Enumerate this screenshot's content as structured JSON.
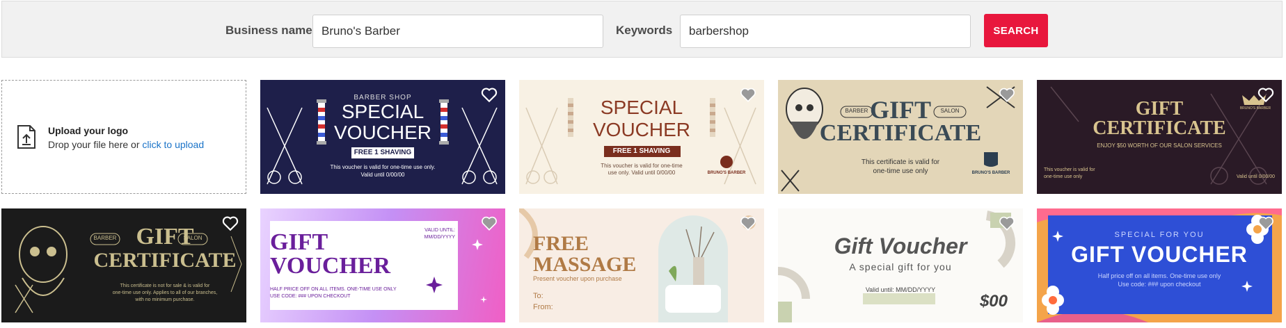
{
  "search": {
    "business_label": "Business name",
    "business_value": "Bruno's Barber",
    "keywords_label": "Keywords",
    "keywords_value": "barbershop",
    "button": "SEARCH"
  },
  "upload": {
    "title": "Upload your logo",
    "text": "Drop your file here or",
    "link": "click to upload"
  },
  "colors": {
    "accent": "#e8173d",
    "link": "#1a73c8"
  },
  "cards": [
    {
      "kicker": "BARBER SHOP",
      "line1": "SPECIAL",
      "line2": "VOUCHER",
      "ribbon": "FREE 1 SHAVING",
      "foot1": "This voucher is valid for one-time use only.",
      "foot2": "Valid until 0/00/00"
    },
    {
      "line1": "SPECIAL",
      "line2": "VOUCHER",
      "ribbon": "FREE 1 SHAVING",
      "foot1": "This voucher is valid for one-time",
      "foot2": "use only. Valid until 0/00/00",
      "brand": "BRUNO'S BARBER"
    },
    {
      "left": "BARBER",
      "right": "SALON",
      "line1": "GIFT",
      "line2": "CERTIFICATE",
      "foot1": "This certificate is valid for",
      "foot2": "one-time use only",
      "brand": "BRUNO'S BARBER"
    },
    {
      "line1": "GIFT",
      "line2": "CERTIFICATE",
      "sub": "ENJOY $50 WORTH OF OUR SALON SERVICES",
      "foot1": "This voucher is valid for",
      "foot2": "one-time use only",
      "date": "Valid until 0/00/00",
      "brand": "BRUNO'S BARBER"
    },
    {
      "left": "BARBER",
      "right": "SALON",
      "line1": "GIFT",
      "line2": "CERTIFICATE",
      "foot1": "This certificate is not for sale & is valid for",
      "foot2": "one-time use only. Applies to all of our branches,",
      "foot3": "with no minimum purchase."
    },
    {
      "line1": "GIFT",
      "line2": "VOUCHER",
      "valid1": "VALID UNTIL:",
      "valid2": "MM/DD/YYYY",
      "foot1": "HALF PRICE OFF ON ALL ITEMS. ONE-TIME USE ONLY",
      "foot2": "USE CODE: ### UPON CHECKOUT"
    },
    {
      "line1": "FREE",
      "line2": "MASSAGE",
      "sub": "Present voucher upon purchase",
      "to": "To:",
      "from": "From:"
    },
    {
      "line1": "Gift Voucher",
      "line2": "A special gift for you",
      "valid": "Valid until: MM/DD/YYYY",
      "amount": "$00"
    },
    {
      "kicker": "SPECIAL FOR YOU",
      "line1": "GIFT VOUCHER",
      "foot1": "Half price off on all items. One-time use only",
      "foot2": "Use code: ### upon checkout"
    }
  ]
}
